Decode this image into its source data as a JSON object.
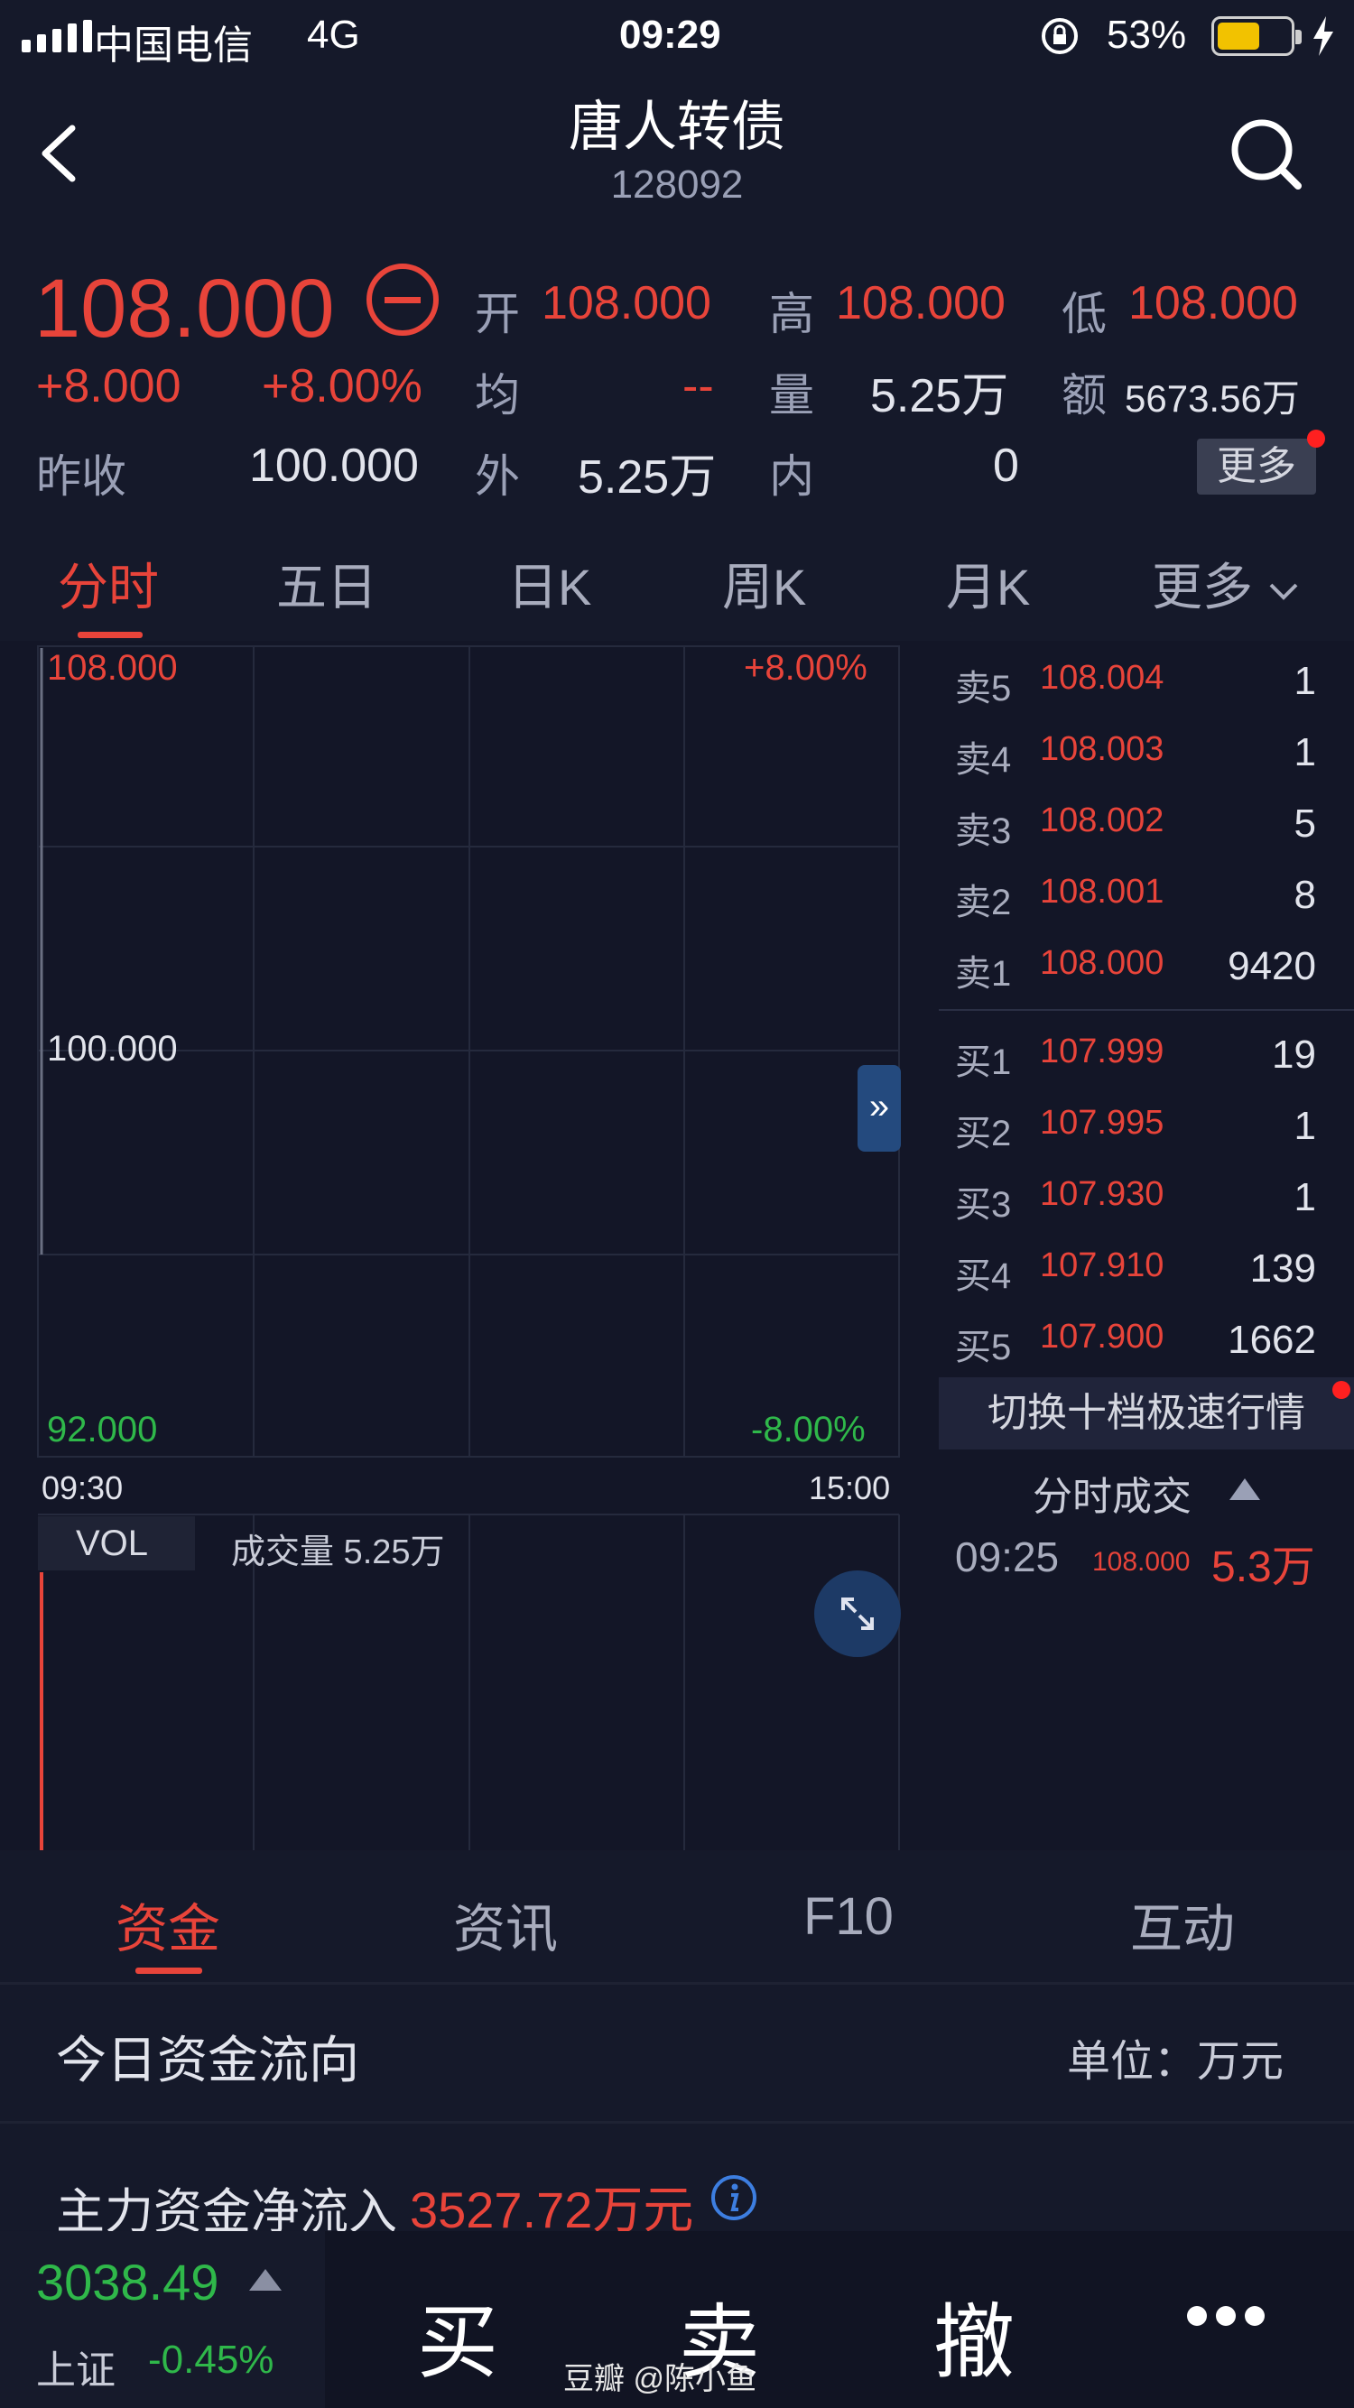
{
  "status_bar": {
    "carrier": "中国电信",
    "network": "4G",
    "time": "09:29",
    "battery": "53%"
  },
  "header": {
    "title": "唐人转债",
    "code": "128092"
  },
  "quote": {
    "price": "108.000",
    "change": "+8.000",
    "change_pct": "+8.00%",
    "open_label": "开",
    "open": "108.000",
    "high_label": "高",
    "high": "108.000",
    "low_label": "低",
    "low": "108.000",
    "avg_label": "均",
    "avg": "--",
    "volume_label": "量",
    "volume": "5.25万",
    "amount_label": "额",
    "amount": "5673.56万",
    "prev_close_label": "昨收",
    "prev_close": "100.000",
    "outer_label": "外",
    "outer": "5.25万",
    "inner_label": "内",
    "inner": "0",
    "more": "更多"
  },
  "tabs": [
    "分时",
    "五日",
    "日K",
    "周K",
    "月K",
    "更多"
  ],
  "chart": {
    "y_top": "108.000",
    "y_mid": "100.000",
    "y_bottom": "92.000",
    "pct_top": "+8.00%",
    "pct_bottom": "-8.00%",
    "time_start": "09:30",
    "time_end": "15:00",
    "vol_label": "VOL",
    "vol_text": "成交量 5.25万"
  },
  "order_book": {
    "asks": [
      {
        "label": "卖5",
        "price": "108.004",
        "vol": "1"
      },
      {
        "label": "卖4",
        "price": "108.003",
        "vol": "1"
      },
      {
        "label": "卖3",
        "price": "108.002",
        "vol": "5"
      },
      {
        "label": "卖2",
        "price": "108.001",
        "vol": "8"
      },
      {
        "label": "卖1",
        "price": "108.000",
        "vol": "9420"
      }
    ],
    "bids": [
      {
        "label": "买1",
        "price": "107.999",
        "vol": "19"
      },
      {
        "label": "买2",
        "price": "107.995",
        "vol": "1"
      },
      {
        "label": "买3",
        "price": "107.930",
        "vol": "1"
      },
      {
        "label": "买4",
        "price": "107.910",
        "vol": "139"
      },
      {
        "label": "买5",
        "price": "107.900",
        "vol": "1662"
      }
    ],
    "switch_label": "切换十档极速行情",
    "ticks_title": "分时成交",
    "tick": {
      "time": "09:25",
      "price": "108.000",
      "vol": "5.3万"
    }
  },
  "bottom_tabs": [
    "资金",
    "资讯",
    "F10",
    "互动"
  ],
  "funds": {
    "title": "今日资金流向",
    "unit": "单位：万元",
    "net_inflow_label": "主力资金净流入",
    "net_inflow_value": "3527.72万元"
  },
  "bottom_bar": {
    "index_value": "3038.49",
    "index_name": "上证",
    "index_change": "-0.45%",
    "buy": "买",
    "sell": "卖",
    "cancel": "撤",
    "watermark": "豆瓣 @陈小鱼"
  },
  "colors": {
    "up": "#e8443a",
    "down": "#2fb84a",
    "background": "#15192a"
  }
}
